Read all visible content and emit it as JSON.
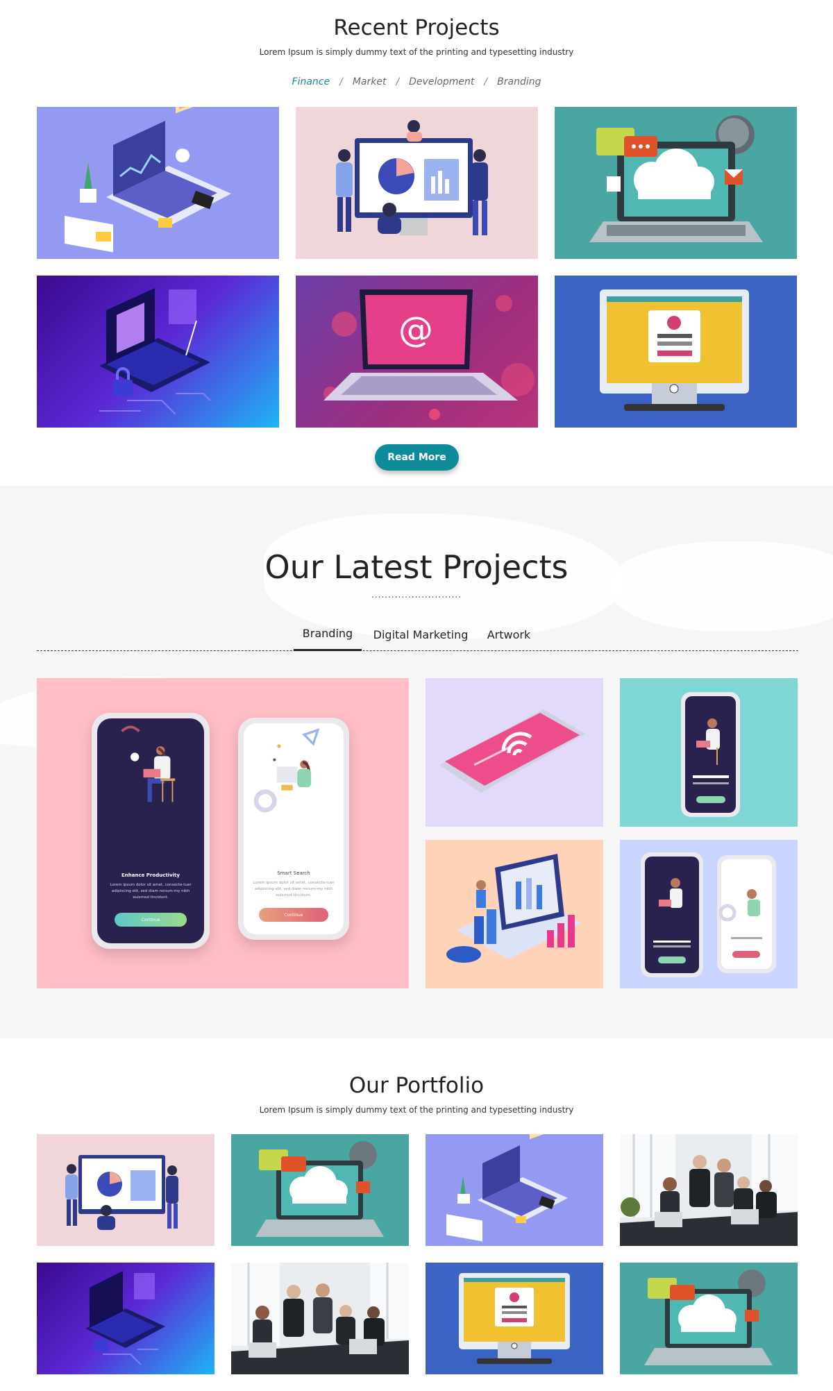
{
  "recent": {
    "title": "Recent Projects",
    "subtitle": "Lorem Ipsum is simply dummy text of the printing and typesetting industry",
    "filters": [
      "Finance",
      "Market",
      "Development",
      "Branding"
    ],
    "active_filter": "Finance",
    "separator": "/",
    "read_more": "Read More"
  },
  "latest": {
    "title": "Our Latest Projects",
    "dots": "...........................",
    "tabs": [
      "Branding",
      "Digital Marketing",
      "Artwork"
    ],
    "active_tab": "Branding",
    "phone_left": {
      "heading": "Enhance Productivity",
      "body": "Lorem ipsum dolor sit amet, consecte-tuer adipiscing elit, sed diam nonum-my nibh euismod tincidunt.",
      "button": "Continue"
    },
    "phone_right": {
      "heading": "Smart Search",
      "body": "Lorem ipsum dolor sit amet, consecte-tuer adipiscing elit, sed diam nonum-my nibh euismod tincidunt.",
      "button": "Continue"
    }
  },
  "portfolio": {
    "title": "Our Portfolio",
    "subtitle": "Lorem Ipsum is simply dummy text of the printing and typesetting industry"
  },
  "colors": {
    "accent": "#0e8b98",
    "active_filter": "#1a8a97"
  }
}
